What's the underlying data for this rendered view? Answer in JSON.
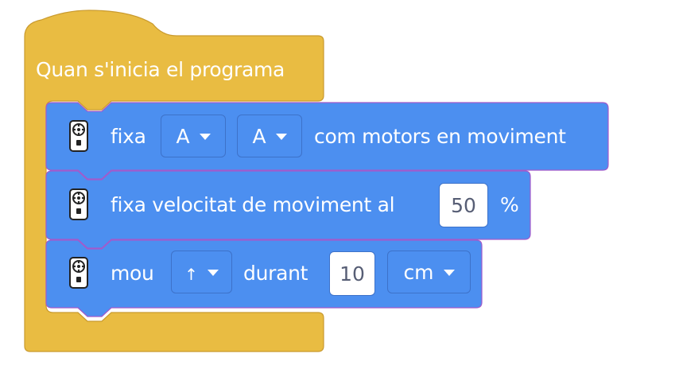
{
  "colors": {
    "event": "#e9bc42",
    "event_border": "#c99a2e",
    "motion": "#4c8ff0",
    "motion_border": "#3d72c9"
  },
  "event_block": {
    "label": "Quan s'inicia el programa"
  },
  "blocks": [
    {
      "icon": "remote-control-icon",
      "word1": "fixa",
      "port1": "A",
      "port2": "A",
      "tail": "com motors en moviment"
    },
    {
      "icon": "remote-control-icon",
      "label": "fixa velocitat de moviment al",
      "value": "50",
      "unit": "%"
    },
    {
      "icon": "remote-control-icon",
      "word1": "mou",
      "direction": "↑",
      "word2": "durant",
      "value": "10",
      "unit": "cm"
    }
  ]
}
